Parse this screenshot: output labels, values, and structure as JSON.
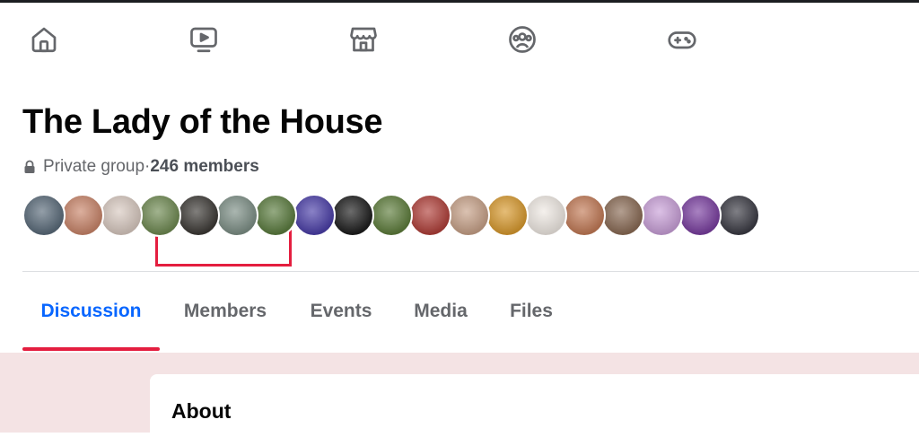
{
  "nav": {
    "icons": [
      "home-icon",
      "video-icon",
      "marketplace-icon",
      "groups-icon",
      "gaming-icon"
    ]
  },
  "group": {
    "title": "The Lady of the House",
    "privacy": "Private group",
    "separator": " · ",
    "members_count": "246 members"
  },
  "avatars": {
    "colors": [
      "#5a6b7a",
      "#c9856a",
      "#d8c9c0",
      "#6f8a52",
      "#3d3a36",
      "#7d8f86",
      "#5b7c3f",
      "#4b3fa8",
      "#1d1d1d",
      "#5e7d3c",
      "#b0403a",
      "#c7a188",
      "#d89a2f",
      "#efe9e3",
      "#c27a56",
      "#8a6b55",
      "#c9a0d8",
      "#7a3fa0",
      "#3b3b44"
    ]
  },
  "tabs": {
    "items": [
      "Discussion",
      "Members",
      "Events",
      "Media",
      "Files"
    ],
    "active": "Discussion"
  },
  "about": {
    "title": "About"
  },
  "colors": {
    "accent": "#0866ff",
    "underline": "#e41e3f",
    "highlight": "#e41e3f",
    "lower_bg": "#f4e3e4"
  }
}
